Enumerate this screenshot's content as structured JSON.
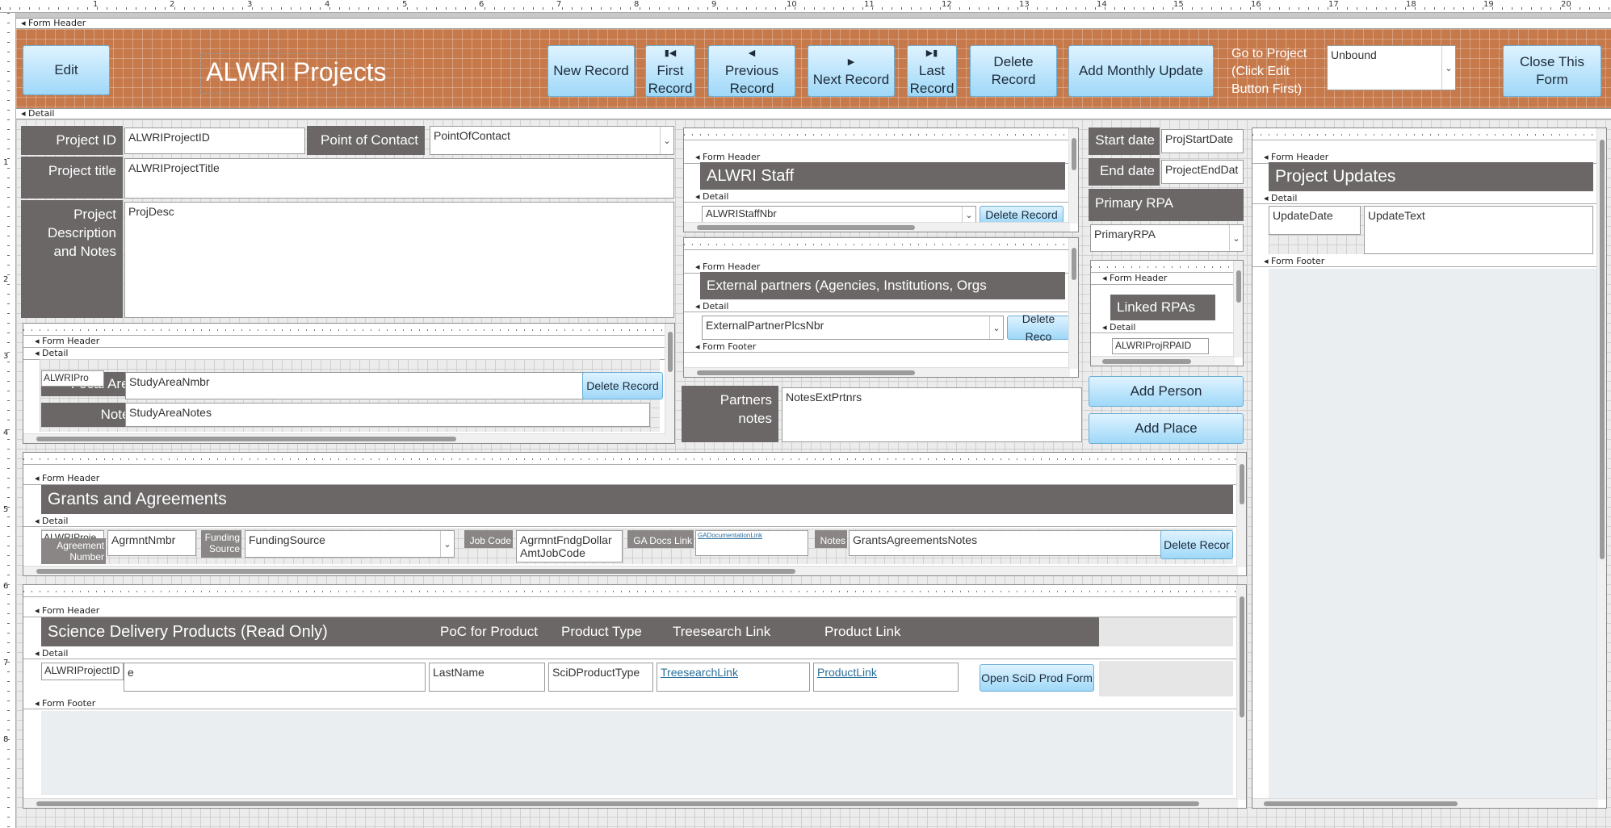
{
  "sections": {
    "form_header": "Form Header",
    "detail": "Detail",
    "form_footer": "Form Footer"
  },
  "ruler_numbers": [
    "1",
    "2",
    "3",
    "4",
    "5",
    "6",
    "7",
    "8",
    "9",
    "10",
    "11",
    "12",
    "13",
    "14",
    "15",
    "16",
    "17",
    "18",
    "19",
    "20"
  ],
  "vruler_numbers": [
    "1",
    "2",
    "3",
    "4",
    "5",
    "6",
    "7",
    "8"
  ],
  "header": {
    "edit_button": "Edit",
    "title": "ALWRI Projects",
    "new_record": "New Record",
    "first_record": "First Record",
    "previous_record": "Previous Record",
    "next_record": "Next Record",
    "last_record": "Last Record",
    "delete_record": "Delete Record",
    "add_monthly_update": "Add Monthly Update",
    "goto_label": "Go to Project (Click Edit Button First)",
    "goto_value": "Unbound",
    "close_form": "Close This Form"
  },
  "project": {
    "id_label": "Project ID",
    "id_value": "ALWRIProjectID",
    "poc_label": "Point of Contact",
    "poc_value": "PointOfContact",
    "title_label": "Project title",
    "title_value": "ALWRIProjectTitle",
    "desc_label": "Project Description and Notes",
    "desc_value": "ProjDesc"
  },
  "study_area": {
    "hidden_field": "ALWRIPro",
    "focal_label": "Focal Area",
    "focal_value": "StudyAreaNmbr",
    "delete_button": "Delete Record",
    "notes_label": "Notes",
    "notes_value": "StudyAreaNotes"
  },
  "staff": {
    "title": "ALWRI Staff",
    "field": "ALWRIStaffNbr",
    "delete_button": "Delete Record"
  },
  "partners": {
    "title": "External partners (Agencies, Institutions, Orgs",
    "field": "ExternalPartnerPlcsNbr",
    "delete_button": "Delete Reco",
    "notes_label": "Partners notes",
    "notes_value": "NotesExtPrtnrs"
  },
  "dates": {
    "start_label": "Start date",
    "start_value": "ProjStartDate",
    "end_label": "End date",
    "end_value": "ProjectEndDat"
  },
  "rpa": {
    "primary_label": "Primary RPA",
    "primary_value": "PrimaryRPA",
    "linked_title": "Linked RPAs",
    "linked_field": "ALWRIProjRPAID"
  },
  "buttons": {
    "add_person": "Add Person",
    "add_place": "Add Place"
  },
  "updates": {
    "title": "Project Updates",
    "date_col": "UpdateDate",
    "text_col": "UpdateText"
  },
  "grants": {
    "title": "Grants and Agreements",
    "hidden_a": "ALWRIProje",
    "hidden_b": "Agreement Number",
    "agr_value": "AgrmntNmbr",
    "funding_label": "Funding Source",
    "funding_value": "FundingSource",
    "jobcode_label": "Job Code",
    "jobcode_value": "AgrmntFndgDollarAmtJobCode",
    "docs_label": "GA Docs Link",
    "docs_value": "GADocumentationLink",
    "notes_label": "Notes",
    "notes_value": "GrantsAgreementsNotes",
    "delete_button": "Delete Recor"
  },
  "scid": {
    "title": "Science Delivery Products (Read Only)",
    "col_poc": "PoC for Product",
    "col_type": "Product Type",
    "col_treesearch": "Treesearch Link",
    "col_link": "Product Link",
    "row_id": "ALWRIProjectID",
    "row_e": "e",
    "row_lastname": "LastName",
    "row_type": "SciDProductType",
    "row_treesearch": "TreesearchLink",
    "row_link": "ProductLink",
    "open_button": "Open SciD Prod Form"
  }
}
